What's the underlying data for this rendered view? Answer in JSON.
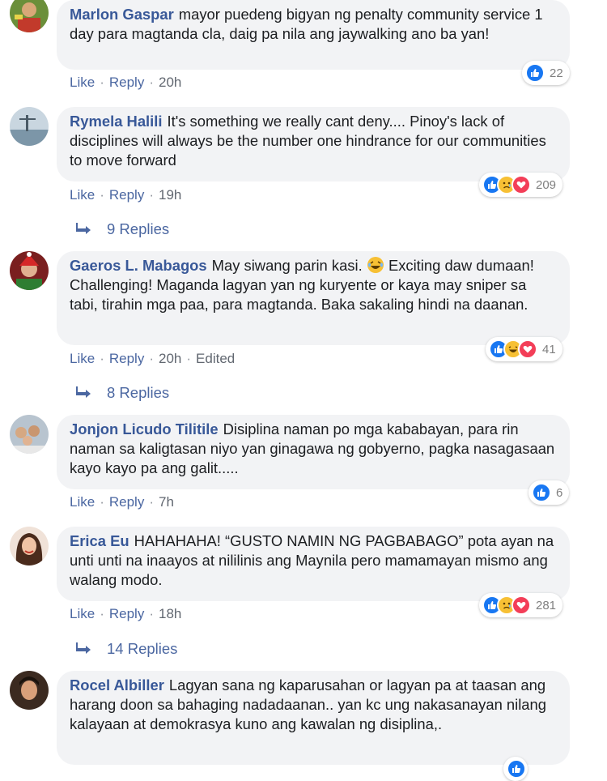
{
  "comments": [
    {
      "author": "Marlon Gaspar",
      "text": "mayor puedeng bigyan ng penalty community service 1 day para magtanda cla, daig pa nila ang jaywalking ano ba yan!",
      "like": "Like",
      "reply": "Reply",
      "time": "20h",
      "reaction_count": "22",
      "reactions": [
        "like-icon"
      ]
    },
    {
      "author": "Rymela Halili",
      "text": "It's something we really cant deny.... Pinoy's lack of disciplines will always be the number one hindrance for our communities to move forward",
      "like": "Like",
      "reply": "Reply",
      "time": "19h",
      "reaction_count": "209",
      "reactions": [
        "like-icon",
        "sad-icon",
        "love-icon"
      ],
      "replies": "9 Replies"
    },
    {
      "author": "Gaeros L. Mabagos",
      "text_before_emoji": "May siwang parin kasi.",
      "inline_emoji": "laughing-emoji",
      "text_after_emoji": "Exciting daw dumaan! Challenging! Maganda lagyan yan ng kuryente or kaya may sniper sa tabi, tirahin mga paa, para magtanda. Baka sakaling hindi na daanan.",
      "like": "Like",
      "reply": "Reply",
      "time": "20h",
      "edited": "Edited",
      "reaction_count": "41",
      "reactions": [
        "like-icon",
        "haha-icon",
        "love-icon"
      ],
      "replies": "8 Replies"
    },
    {
      "author": "Jonjon Licudo Tilitile",
      "text": "Disiplina naman po mga kababayan, para rin naman sa kaligtasan niyo yan ginagawa ng gobyerno, pagka nasagasaan kayo kayo pa ang galit.....",
      "like": "Like",
      "reply": "Reply",
      "time": "7h",
      "reaction_count": "6",
      "reactions": [
        "like-icon"
      ]
    },
    {
      "author": "Erica Eu",
      "text": "HAHAHAHA! “GUSTO NAMIN NG PAGBABAGO” pota ayan na unti unti na inaayos at nililinis ang Maynila pero mamamayan mismo ang walang modo.",
      "like": "Like",
      "reply": "Reply",
      "time": "18h",
      "reaction_count": "281",
      "reactions": [
        "like-icon",
        "sad-icon",
        "love-icon"
      ],
      "replies": "14 Replies"
    },
    {
      "author": "Rocel Albiller",
      "text": "Lagyan sana ng kaparusahan or lagyan pa at taasan ang harang doon sa bahaging nadadaanan.. yan kc ung nakasanayan nilang kalayaan at demokrasya kuno ang kawalan ng disiplina,.",
      "reactions": [
        "like-icon"
      ]
    }
  ],
  "colors": {
    "author": "#385898",
    "link": "#4b67a1",
    "bubble": "#f2f3f5",
    "like_blue": "#1877f2",
    "love_red": "#f33e58",
    "sad_yellow": "#f7c034"
  }
}
